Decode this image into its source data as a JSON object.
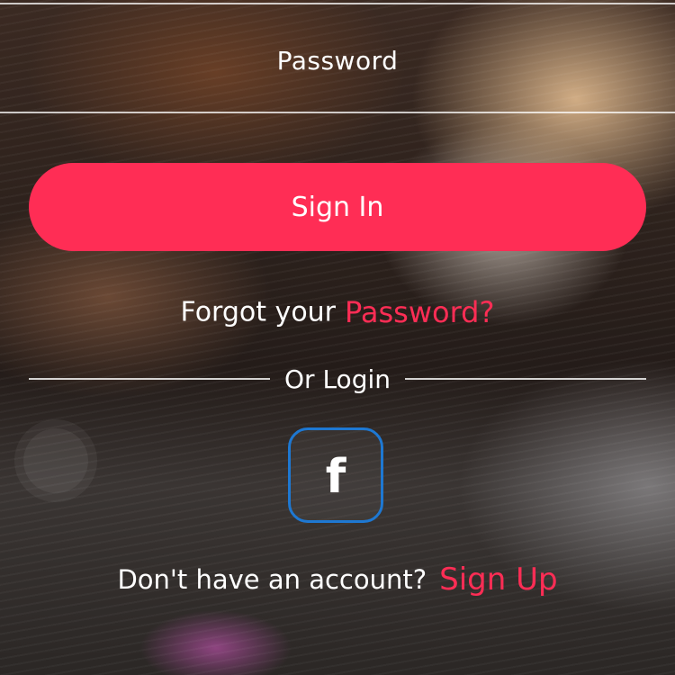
{
  "login_form": {
    "password_placeholder": "Password",
    "password_value": "",
    "signin_label": "Sign In",
    "forgot_prefix": "Forgot your",
    "forgot_link": "Password?",
    "divider_label": "Or Login",
    "social": {
      "facebook_glyph": "f",
      "facebook_icon": "facebook-icon"
    },
    "signup_prompt": "Don't have an account?",
    "signup_link": "Sign Up"
  },
  "colors": {
    "accent": "#ff2d55",
    "facebook_border": "#1e78d2",
    "text": "#ffffff"
  }
}
